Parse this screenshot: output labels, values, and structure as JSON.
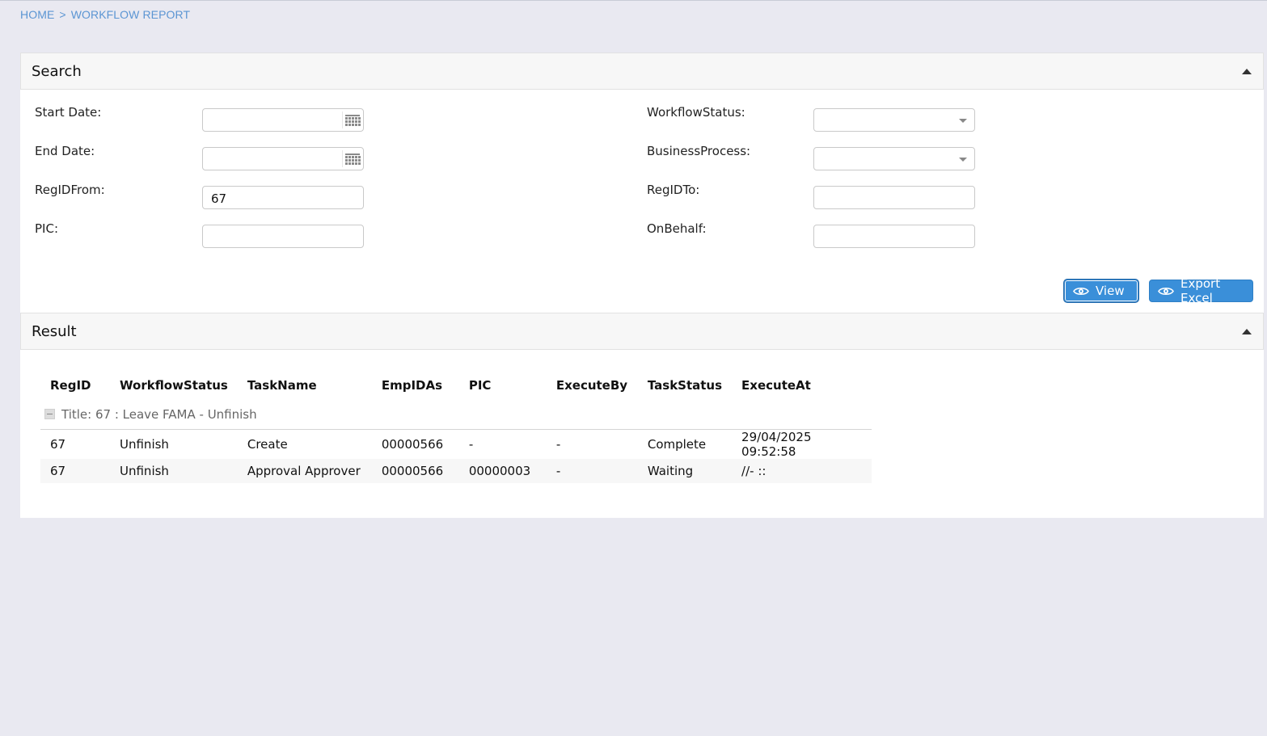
{
  "breadcrumb": {
    "home": "HOME",
    "separator": ">",
    "current": "WORKFLOW REPORT"
  },
  "search": {
    "title": "Search",
    "start_date_label": "Start Date:",
    "start_date_value": "",
    "end_date_label": "End Date:",
    "end_date_value": "",
    "regid_from_label": "RegIDFrom:",
    "regid_from_value": "67",
    "pic_label": "PIC:",
    "pic_value": "",
    "workflow_status_label": "WorkflowStatus:",
    "workflow_status_value": "",
    "business_process_label": "BusinessProcess:",
    "business_process_value": "",
    "regid_to_label": "RegIDTo:",
    "regid_to_value": "",
    "on_behalf_label": "OnBehalf:",
    "on_behalf_value": "",
    "view_label": "View",
    "export_label": "Export Excel"
  },
  "result": {
    "title": "Result",
    "columns": [
      "RegID",
      "WorkflowStatus",
      "TaskName",
      "EmpIDAs",
      "PIC",
      "ExecuteBy",
      "TaskStatus",
      "ExecuteAt"
    ],
    "group_title": "Title: 67 : Leave FAMA - Unfinish",
    "rows": [
      [
        "67",
        "Unfinish",
        "Create",
        "00000566",
        "-",
        "-",
        "Complete",
        "29/04/2025 09:52:58"
      ],
      [
        "67",
        "Unfinish",
        "Approval Approver",
        "00000566",
        "00000003",
        "-",
        "Waiting",
        "//- ::"
      ]
    ]
  },
  "colors": {
    "accent": "#3a8fd9",
    "breadcrumb": "#5b95d3",
    "background": "#e9e9f1"
  }
}
